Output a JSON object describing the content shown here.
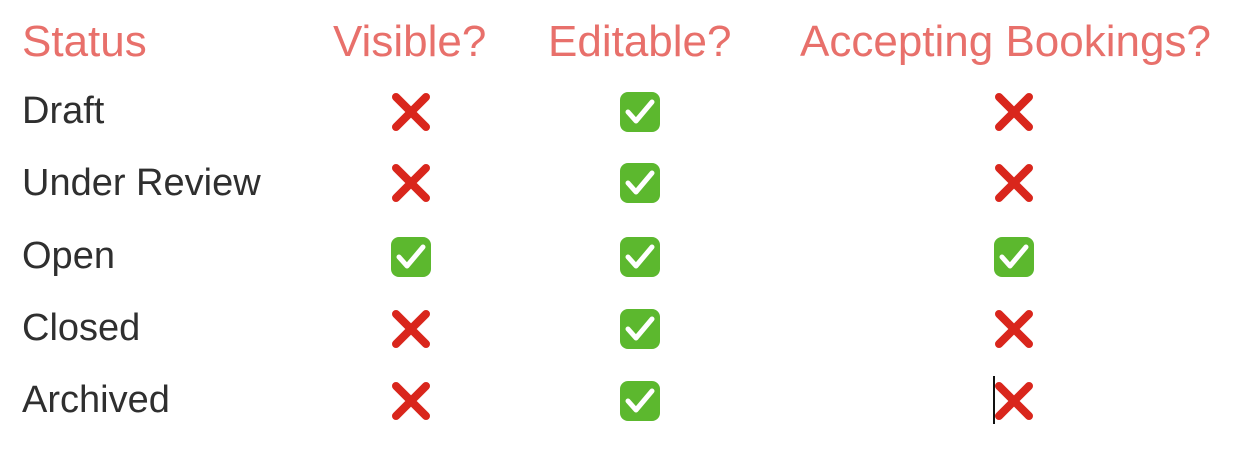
{
  "table": {
    "headers": {
      "status": "Status",
      "visible": "Visible?",
      "editable": "Editable?",
      "accepting_bookings": "Accepting Bookings?"
    },
    "rows": [
      {
        "status": "Draft",
        "visible": false,
        "editable": true,
        "accepting_bookings": false
      },
      {
        "status": "Under Review",
        "visible": false,
        "editable": true,
        "accepting_bookings": false
      },
      {
        "status": "Open",
        "visible": true,
        "editable": true,
        "accepting_bookings": true
      },
      {
        "status": "Closed",
        "visible": false,
        "editable": true,
        "accepting_bookings": false
      },
      {
        "status": "Archived",
        "visible": false,
        "editable": true,
        "accepting_bookings": false
      }
    ]
  },
  "icons": {
    "yes": "check-mark-button-icon",
    "no": "cross-mark-icon"
  },
  "colors": {
    "header": "#e8706b",
    "body_text": "#2f2f2f",
    "check_bg": "#5cb82e",
    "cross": "#d9261c"
  }
}
